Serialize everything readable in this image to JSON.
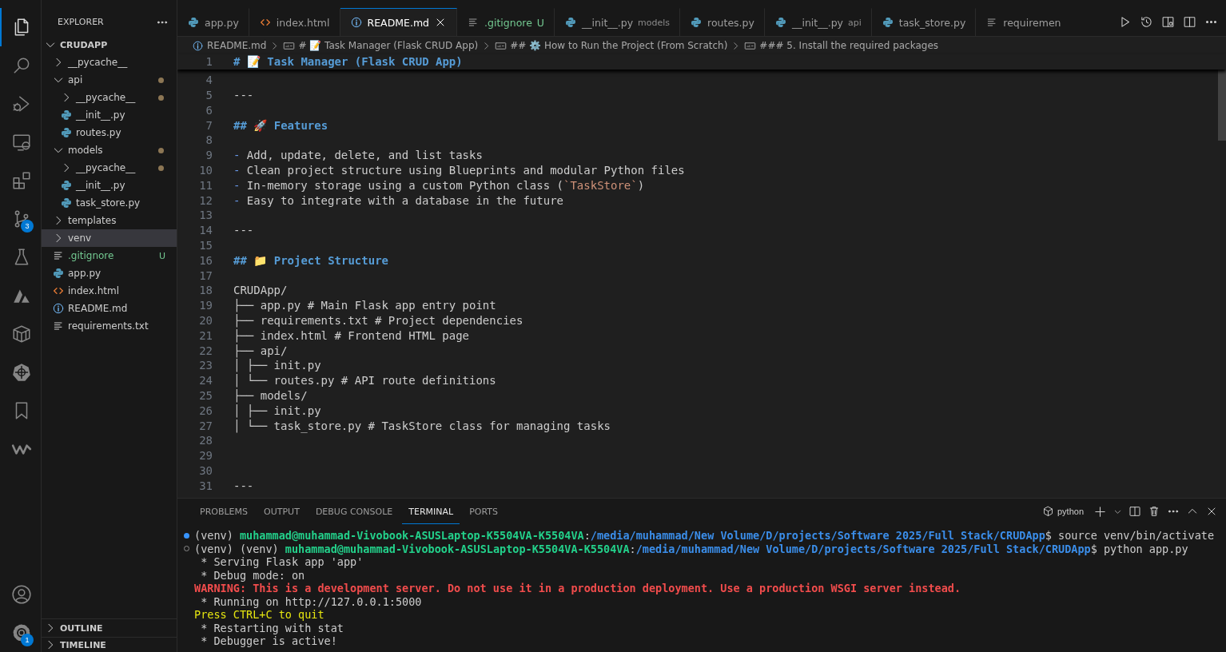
{
  "activity_bar": {
    "top": [
      {
        "kind": "explorer",
        "selected": true
      },
      {
        "kind": "search",
        "selected": false
      },
      {
        "kind": "run-debug",
        "selected": false
      },
      {
        "kind": "remote",
        "selected": false
      },
      {
        "kind": "extensions",
        "selected": false
      },
      {
        "kind": "source-control",
        "selected": false,
        "badge": "3"
      },
      {
        "kind": "testing",
        "selected": false
      },
      {
        "kind": "azure",
        "selected": false
      },
      {
        "kind": "containers",
        "selected": false
      },
      {
        "kind": "kubernetes",
        "selected": false
      },
      {
        "kind": "bookmarks",
        "selected": false
      },
      {
        "kind": "w-logo",
        "selected": false
      }
    ],
    "bottom": [
      {
        "kind": "accounts",
        "selected": false
      },
      {
        "kind": "manage",
        "selected": false,
        "badge": "1"
      }
    ]
  },
  "explorer": {
    "title": "EXPLORER",
    "root": {
      "label": "CRUDAPP",
      "kind": "folder",
      "expanded": true,
      "children": [
        {
          "label": "__pycache__",
          "kind": "folder",
          "expanded": false,
          "selected": false
        },
        {
          "label": "api",
          "kind": "folder",
          "expanded": true,
          "selected": false,
          "modified": true,
          "children": [
            {
              "label": "__pycache__",
              "kind": "folder",
              "expanded": false,
              "selected": false,
              "modified": true
            },
            {
              "label": "__init__.py",
              "kind": "python",
              "selected": false
            },
            {
              "label": "routes.py",
              "kind": "python",
              "selected": false
            }
          ]
        },
        {
          "label": "models",
          "kind": "folder",
          "expanded": true,
          "selected": false,
          "modified": true,
          "children": [
            {
              "label": "__pycache__",
              "kind": "folder",
              "expanded": false,
              "selected": false,
              "modified": true
            },
            {
              "label": "__init__.py",
              "kind": "python",
              "selected": false
            },
            {
              "label": "task_store.py",
              "kind": "python",
              "selected": false
            }
          ]
        },
        {
          "label": "templates",
          "kind": "folder",
          "expanded": false,
          "selected": false
        },
        {
          "label": "venv",
          "kind": "folder",
          "expanded": false,
          "selected": true
        },
        {
          "label": ".gitignore",
          "kind": "lines",
          "selected": false,
          "git_status": "U"
        },
        {
          "label": "app.py",
          "kind": "python",
          "selected": false
        },
        {
          "label": "index.html",
          "kind": "html",
          "selected": false
        },
        {
          "label": "README.md",
          "kind": "info",
          "selected": false
        },
        {
          "label": "requirements.txt",
          "kind": "lines",
          "selected": false
        }
      ]
    },
    "sections": [
      {
        "label": "OUTLINE",
        "expanded": false
      },
      {
        "label": "TIMELINE",
        "expanded": false
      }
    ]
  },
  "tabs": [
    {
      "label": "app.py",
      "kind": "python",
      "selected": false
    },
    {
      "label": "index.html",
      "kind": "html",
      "selected": false
    },
    {
      "label": "README.md",
      "kind": "info",
      "selected": true
    },
    {
      "label": ".gitignore",
      "kind": "lines",
      "selected": false,
      "git_status": "U"
    },
    {
      "label": "__init__.py",
      "kind": "python",
      "selected": false,
      "description": "models"
    },
    {
      "label": "routes.py",
      "kind": "python",
      "selected": false
    },
    {
      "label": "__init__.py",
      "kind": "python",
      "selected": false,
      "description": "api"
    },
    {
      "label": "task_store.py",
      "kind": "python",
      "selected": false
    },
    {
      "label": "requiremen",
      "kind": "lines",
      "selected": false
    }
  ],
  "breadcrumbs": [
    {
      "kind": "file",
      "text": "README.md"
    },
    {
      "kind": "symbol",
      "text": "# 📝 Task Manager (Flask CRUD App)"
    },
    {
      "kind": "symbol",
      "text": "## ⚙️ How to Run the Project (From Scratch)"
    },
    {
      "kind": "symbol",
      "text": "### 5. Install the required packages"
    }
  ],
  "editor": {
    "sticky_line": {
      "number": "1",
      "parts": [
        {
          "kind": "heading",
          "text": "# 📝 Task Manager (Flask CRUD App)"
        }
      ]
    },
    "lines": [
      {
        "number": "4"
      },
      {
        "number": "5",
        "parts": [
          {
            "kind": "text",
            "text": "---"
          }
        ]
      },
      {
        "number": "6"
      },
      {
        "number": "7",
        "parts": [
          {
            "kind": "heading",
            "text": "## 🚀 Features"
          }
        ]
      },
      {
        "number": "8"
      },
      {
        "number": "9",
        "parts": [
          {
            "kind": "marker",
            "text": "-"
          },
          {
            "kind": "text",
            "text": "Add, update, delete, and list tasks"
          }
        ]
      },
      {
        "number": "10",
        "parts": [
          {
            "kind": "marker",
            "text": "-"
          },
          {
            "kind": "text",
            "text": "Clean project structure using Blueprints and modular Python files"
          }
        ]
      },
      {
        "number": "11",
        "parts": [
          {
            "kind": "marker",
            "text": "-"
          },
          {
            "kind": "text",
            "text": "In-memory storage using a custom Python class ("
          },
          {
            "kind": "code",
            "text": "`TaskStore`"
          },
          {
            "kind": "text",
            "text": ")"
          }
        ]
      },
      {
        "number": "12",
        "parts": [
          {
            "kind": "marker",
            "text": "-"
          },
          {
            "kind": "text",
            "text": "Easy to integrate with a database in the future"
          }
        ]
      },
      {
        "number": "13"
      },
      {
        "number": "14",
        "parts": [
          {
            "kind": "text",
            "text": "---"
          }
        ]
      },
      {
        "number": "15"
      },
      {
        "number": "16",
        "parts": [
          {
            "kind": "heading",
            "text": "## 📁 Project Structure"
          }
        ]
      },
      {
        "number": "17"
      },
      {
        "number": "18",
        "parts": [
          {
            "kind": "text",
            "text": "CRUDApp/"
          }
        ]
      },
      {
        "number": "19",
        "parts": [
          {
            "kind": "text",
            "text": "├── app.py # Main Flask app entry point"
          }
        ]
      },
      {
        "number": "20",
        "parts": [
          {
            "kind": "text",
            "text": "├── requirements.txt # Project dependencies"
          }
        ]
      },
      {
        "number": "21",
        "parts": [
          {
            "kind": "text",
            "text": "├── index.html # Frontend HTML page"
          }
        ]
      },
      {
        "number": "22",
        "parts": [
          {
            "kind": "text",
            "text": "├── api/"
          }
        ]
      },
      {
        "number": "23",
        "parts": [
          {
            "kind": "text",
            "text": "│ ├── init.py"
          }
        ]
      },
      {
        "number": "24",
        "parts": [
          {
            "kind": "text",
            "text": "│ └── routes.py # API route definitions"
          }
        ]
      },
      {
        "number": "25",
        "parts": [
          {
            "kind": "text",
            "text": "├── models/"
          }
        ]
      },
      {
        "number": "26",
        "parts": [
          {
            "kind": "text",
            "text": "│ ├── init.py"
          }
        ]
      },
      {
        "number": "27",
        "parts": [
          {
            "kind": "text",
            "text": "│ └── task_store.py # TaskStore class for managing tasks"
          }
        ]
      },
      {
        "number": "28"
      },
      {
        "number": "29"
      },
      {
        "number": "30"
      },
      {
        "number": "31",
        "parts": [
          {
            "kind": "text",
            "text": "---"
          }
        ]
      }
    ]
  },
  "panel": {
    "tabs": [
      {
        "label": "PROBLEMS",
        "selected": false
      },
      {
        "label": "OUTPUT",
        "selected": false
      },
      {
        "label": "DEBUG CONSOLE",
        "selected": false
      },
      {
        "label": "TERMINAL",
        "selected": true
      },
      {
        "label": "PORTS",
        "selected": false
      }
    ],
    "terminal_profile": "python",
    "terminal_lines": [
      {
        "finished": true,
        "parts": [
          {
            "kind": "plain",
            "text": "(venv) "
          },
          {
            "kind": "user",
            "text": "muhammad@muhammad-Vivobook-ASUSLaptop-K5504VA-K5504VA"
          },
          {
            "kind": "plain",
            "text": ":"
          },
          {
            "kind": "path",
            "text": "/media/muhammad/New Volume/D/projects/Software 2025/Full Stack/CRUDApp"
          },
          {
            "kind": "plain",
            "text": "$ source venv/bin/activate"
          }
        ]
      },
      {
        "finished": false,
        "parts": [
          {
            "kind": "plain",
            "text": "(venv) (venv) "
          },
          {
            "kind": "user",
            "text": "muhammad@muhammad-Vivobook-ASUSLaptop-K5504VA-K5504VA"
          },
          {
            "kind": "plain",
            "text": ":"
          },
          {
            "kind": "path",
            "text": "/media/muhammad/New Volume/D/projects/Software 2025/Full Stack/CRUDApp"
          },
          {
            "kind": "plain",
            "text": "$ python app.py"
          }
        ]
      },
      {
        "parts": [
          {
            "kind": "plain",
            "text": " * Serving Flask app 'app'"
          }
        ]
      },
      {
        "parts": [
          {
            "kind": "plain",
            "text": " * Debug mode: on"
          }
        ]
      },
      {
        "parts": [
          {
            "kind": "warning",
            "text": "WARNING: This is a development server. Do not use it in a production deployment. Use a production WSGI server instead."
          }
        ]
      },
      {
        "parts": [
          {
            "kind": "plain",
            "text": " * Running on http://127.0.0.1:5000"
          }
        ]
      },
      {
        "parts": [
          {
            "kind": "notice",
            "text": "Press CTRL+C to quit"
          }
        ]
      },
      {
        "parts": [
          {
            "kind": "plain",
            "text": " * Restarting with stat"
          }
        ]
      },
      {
        "parts": [
          {
            "kind": "plain",
            "text": " * Debugger is active!"
          }
        ]
      }
    ]
  }
}
